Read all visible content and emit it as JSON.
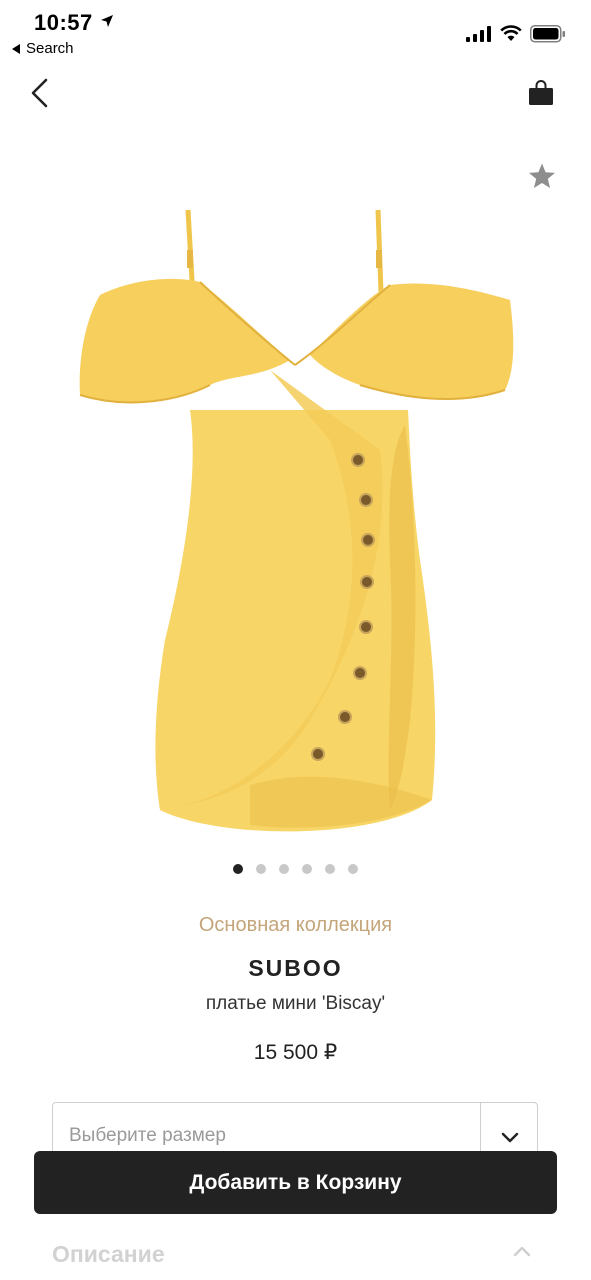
{
  "status_bar": {
    "time": "10:57",
    "back_app_label": "Search"
  },
  "nav": {
    "back_icon": "chevron-left-icon",
    "bag_icon": "shopping-bag-icon",
    "favorite_icon": "star-icon"
  },
  "carousel": {
    "dot_count": 6,
    "active_index": 0
  },
  "product": {
    "collection": "Основная коллекция",
    "brand": "SUBOO",
    "name": "платье мини 'Biscay'",
    "price": "15 500 ₽",
    "image_color": "#f7d466"
  },
  "size_select": {
    "placeholder": "Выберите размер"
  },
  "actions": {
    "add_to_cart": "Добавить в Корзину"
  },
  "description": {
    "title": "Описание"
  },
  "colors": {
    "primary_button": "#222222",
    "collection_text": "#c4a57a",
    "dot_inactive": "#c8c8c8"
  }
}
